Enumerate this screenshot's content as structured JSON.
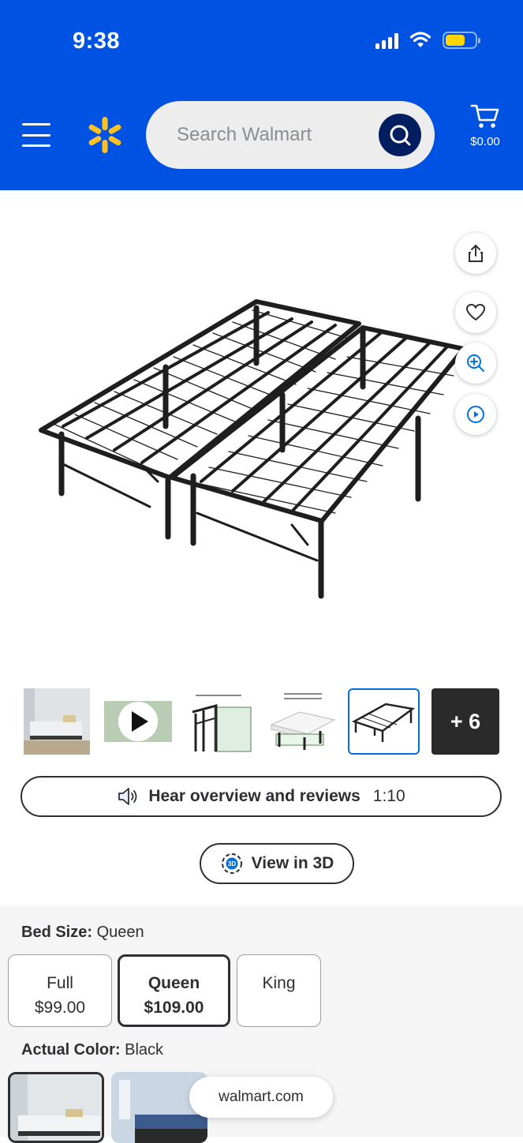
{
  "status_bar": {
    "time": "9:38"
  },
  "header": {
    "search": {
      "placeholder": "Search Walmart"
    },
    "cart": {
      "total": "$0.00"
    }
  },
  "gallery": {
    "more_count_label": "+ 6",
    "actions": [
      "share-icon",
      "heart-icon",
      "zoom-icon",
      "play-circle-icon"
    ]
  },
  "audio": {
    "label": "Hear overview and reviews",
    "duration": "1:10"
  },
  "view3d": {
    "label": "View in 3D"
  },
  "bed_size": {
    "label": "Bed Size:",
    "selected": "Queen",
    "options": [
      {
        "name": "Full",
        "price": "$99.00"
      },
      {
        "name": "Queen",
        "price": "$109.00"
      },
      {
        "name": "King",
        "price": ""
      }
    ]
  },
  "actual_color": {
    "label": "Actual Color:",
    "selected": "Black"
  },
  "browser": {
    "domain": "walmart.com"
  },
  "colors": {
    "brand_blue": "#0053e2",
    "spark_yellow": "#ffc220",
    "search_navy": "#001e60"
  }
}
